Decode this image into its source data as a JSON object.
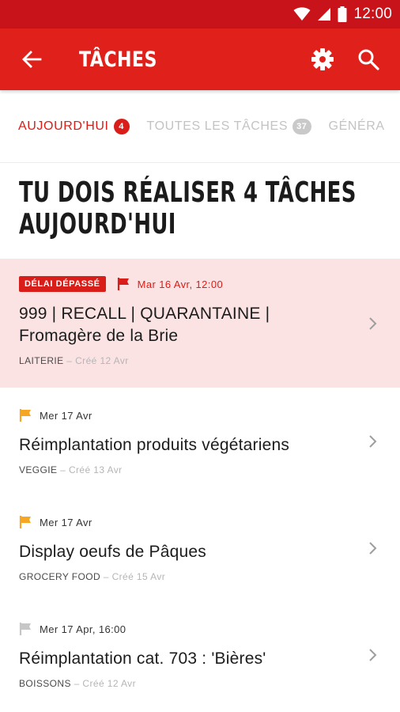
{
  "status_bar": {
    "time": "12:00"
  },
  "app_bar": {
    "title": "TÂCHES"
  },
  "tabs": [
    {
      "label": "AUJOURD'HUI",
      "count": "4",
      "active": true
    },
    {
      "label": "TOUTES LES TÂCHES",
      "count": "37",
      "active": false
    },
    {
      "label": "GÉNÉRA",
      "count": "",
      "active": false
    }
  ],
  "heading": {
    "line1": "TU DOIS RÉALISER 4 TÂCHES",
    "line2": "AUJOURD'HUI"
  },
  "tasks": [
    {
      "overdue_label": "DÉLAI DÉPASSÉ",
      "date": "Mar 16 Avr, 12:00",
      "flag_color": "#d91d18",
      "name_line1": "999 | RECALL | QUARANTAINE |",
      "name_line2": "Fromagère de la Brie",
      "category": "LAITERIE",
      "created": " – Créé 12 Avr"
    },
    {
      "date": "Mer 17 Avr",
      "flag_color": "#f5a623",
      "name": "Réimplantation produits végétariens",
      "category": "VEGGIE",
      "created": " – Créé 13 Avr"
    },
    {
      "date": "Mer 17 Avr",
      "flag_color": "#f5a623",
      "name": "Display oeufs de Pâques",
      "category": "GROCERY FOOD",
      "created": " – Créé 15 Avr"
    },
    {
      "date": "Mer 17 Apr, 16:00",
      "flag_color": "#c6c6c6",
      "name": "Réimplantation cat. 703 : 'Bières'",
      "category": "BOISSONS",
      "created": " – Créé 12 Avr"
    }
  ],
  "colors": {
    "primary": "#e0201a",
    "status_bar": "#c8131a",
    "overdue_bg": "#fbe3e3"
  },
  "icons": {
    "back": "arrow-left-icon",
    "settings": "gear-icon",
    "search": "search-icon",
    "chevron": "chevron-right-icon",
    "flag": "flag-icon"
  }
}
